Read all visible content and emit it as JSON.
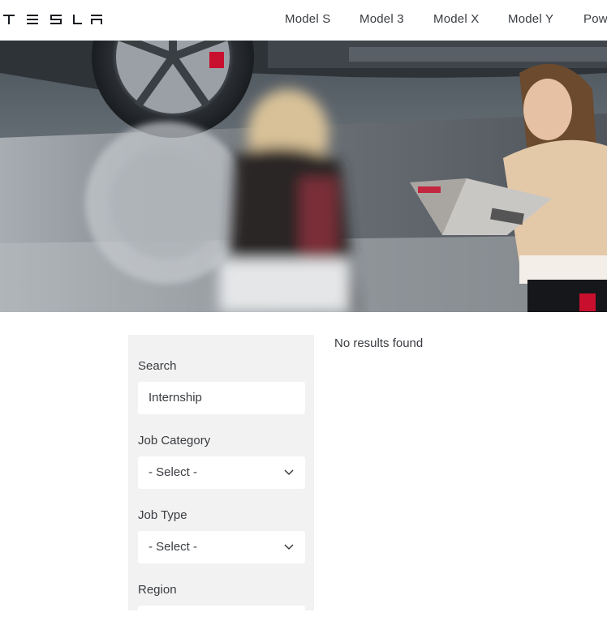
{
  "header": {
    "logo_text": "TESLA",
    "nav": [
      "Model S",
      "Model 3",
      "Model X",
      "Model Y",
      "Powerwall"
    ]
  },
  "hero": {
    "image": "blurred person walking past car, woman holding laptop"
  },
  "filters": {
    "search": {
      "label": "Search",
      "value": "Internship"
    },
    "job_category": {
      "label": "Job Category",
      "selected": "- Select -"
    },
    "job_type": {
      "label": "Job Type",
      "selected": "- Select -"
    },
    "region": {
      "label": "Region"
    }
  },
  "results": {
    "message": "No results found"
  },
  "colors": {
    "text": "#393c41",
    "filter_panel": "#f2f2f2",
    "tesla_red": "#c8102e"
  }
}
